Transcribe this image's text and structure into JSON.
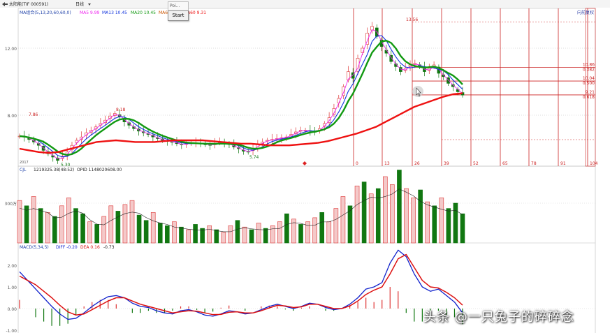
{
  "toolbar": {
    "back_icon": "back-arrow-icon",
    "stock_name": "太阳能(TIF 000591)",
    "period": "日线",
    "period_dropdown_icon": "chevron-down-icon"
  },
  "popup": {
    "tab_text": "Poi...",
    "start_label": "Start"
  },
  "price_panel": {
    "legend_name": "MA组合(5,13,20,60,60,0)",
    "ma5_label": "MA5 9.99",
    "ma13_label": "MA13 10.45",
    "ma20_label": "MA20 10.45",
    "ma_hidden_label": "MA6",
    "ma60_label": "A60 9.31",
    "corner_label": "向前复权",
    "bottom_left_label": "2017",
    "y_ticks": [
      "12.00",
      "8.00"
    ],
    "peak_label": "13.56",
    "annotations": [
      "7.86",
      "8.18",
      "5.30",
      "5.74"
    ],
    "fib_labels": [
      "10.86",
      "0.382",
      "10.04",
      "0.500",
      "9.21",
      "0.618"
    ],
    "time_ticks": [
      "0",
      "13",
      "26",
      "39",
      "52",
      "65",
      "78",
      "91",
      "104"
    ],
    "colors": {
      "ma5": "#ee22ee",
      "ma13": "#1133dd",
      "ma20": "#119911",
      "ma60": "#ee1111",
      "grid": "#cc2222",
      "up": "#dd3333",
      "down": "#117711"
    }
  },
  "volume_panel": {
    "legend_name": "CJL",
    "value_label": "1219325.38(48:52)",
    "opid_label": "OPID 1148020608.00",
    "y_tick": "300万"
  },
  "macd_panel": {
    "legend_name": "MACD(5,34,5)",
    "diff_label": "DIFF -0.20",
    "dea_label": "DEA 0.16",
    "macd_label": "-0.73",
    "y_ticks": [
      "2.00",
      "1.00",
      "0.00",
      "-1.00"
    ]
  },
  "watermark": "头条 @一只兔子的碎碎念",
  "chart_data": [
    {
      "type": "line",
      "title": "",
      "series_names": [
        "MA5",
        "MA13",
        "MA20",
        "MA60"
      ],
      "price_seq": [
        6.75,
        6.7,
        6.55,
        6.4,
        6.2,
        5.9,
        5.7,
        5.5,
        5.3,
        5.55,
        5.8,
        6.2,
        6.5,
        6.7,
        6.95,
        7.1,
        7.3,
        7.5,
        7.7,
        7.95,
        8.1,
        7.9,
        7.6,
        7.4,
        7.2,
        7.05,
        6.95,
        6.85,
        6.7,
        6.6,
        6.5,
        6.45,
        6.4,
        6.3,
        6.25,
        6.3,
        6.35,
        6.35,
        6.3,
        6.25,
        6.2,
        6.3,
        6.4,
        6.35,
        6.25,
        6.1,
        6.0,
        5.85,
        5.8,
        6.0,
        6.25,
        6.4,
        6.5,
        6.55,
        6.6,
        6.65,
        6.7,
        6.85,
        7.0,
        7.1,
        7.1,
        7.05,
        7.0,
        7.2,
        7.5,
        7.85,
        8.4,
        9.0,
        9.7,
        10.6,
        10.2,
        11.4,
        12.0,
        12.9,
        13.3,
        12.7,
        12.1,
        11.7,
        11.2,
        10.9,
        10.6,
        10.8,
        11.0,
        11.1,
        10.9,
        10.6,
        10.8,
        11.0,
        10.5,
        10.3,
        9.9,
        9.7,
        9.4,
        9.2
      ],
      "ma60_seq": [
        6.0,
        5.9,
        5.8,
        5.75,
        5.8,
        5.95,
        6.1,
        6.25,
        6.4,
        6.45,
        6.5,
        6.45,
        6.4,
        6.4,
        6.4,
        6.45,
        6.5,
        6.5,
        6.5,
        6.5,
        6.45,
        6.4,
        6.35,
        6.3,
        6.3,
        6.25,
        6.2,
        6.2,
        6.2,
        6.25,
        6.3,
        6.35,
        6.45,
        6.6,
        6.75,
        6.9,
        7.1,
        7.3,
        7.6,
        7.9,
        8.2,
        8.5,
        8.7,
        8.9,
        9.1,
        9.25,
        9.31
      ],
      "y_ticks": [
        12.0,
        8.0
      ],
      "peak": 13.56,
      "labels": {
        "high1": 7.86,
        "high2": 8.18,
        "low1": 5.3,
        "low2": 5.74
      },
      "fibonacci": [
        {
          "price": 10.86,
          "ratio": 0.382
        },
        {
          "price": 10.04,
          "ratio": 0.5
        },
        {
          "price": 9.21,
          "ratio": 0.618
        }
      ],
      "time_cycle": [
        0,
        13,
        26,
        39,
        52,
        65,
        78,
        91,
        104
      ]
    },
    {
      "type": "bar",
      "title": "",
      "y_ticks": [
        "300万"
      ],
      "volume_seq": [
        3.2,
        2.8,
        3.5,
        2.6,
        2.3,
        2.0,
        2.8,
        3.4,
        2.6,
        2.2,
        1.6,
        1.4,
        2.0,
        2.8,
        2.4,
        2.9,
        3.2,
        2.1,
        1.7,
        2.3,
        1.5,
        1.3,
        1.6,
        1.2,
        1.0,
        1.4,
        1.1,
        1.3,
        1.0,
        0.8,
        1.3,
        1.7,
        1.2,
        1.0,
        1.5,
        1.1,
        1.3,
        1.6,
        2.2,
        1.8,
        1.4,
        1.6,
        1.9,
        2.3,
        1.6,
        2.6,
        3.5,
        2.8,
        4.3,
        4.6,
        3.7,
        4.1,
        5.0,
        4.4,
        5.5,
        4.1,
        3.4,
        4.0,
        3.1,
        2.8,
        3.4,
        2.6,
        3.0,
        2.2
      ],
      "volume_up": [
        1,
        0,
        1,
        0,
        1,
        0,
        1,
        1,
        0,
        0,
        1,
        0,
        1,
        1,
        0,
        1,
        1,
        0,
        0,
        1,
        0,
        0,
        1,
        0,
        1,
        0,
        0,
        1,
        0,
        1,
        1,
        0,
        1,
        0,
        1,
        0,
        1,
        1,
        0,
        1,
        0,
        1,
        1,
        0,
        1,
        1,
        1,
        0,
        1,
        0,
        1,
        0,
        1,
        1,
        0,
        1,
        1,
        0,
        1,
        0,
        1,
        0,
        0,
        0
      ]
    },
    {
      "type": "line",
      "title": "",
      "series_names": [
        "DIFF",
        "DEA",
        "MACD"
      ],
      "y_ticks": [
        2.0,
        1.0,
        0.0,
        -1.0
      ],
      "diff_seq": [
        1.7,
        1.3,
        0.9,
        0.5,
        0.1,
        -0.25,
        -0.5,
        -0.45,
        -0.2,
        0.1,
        0.35,
        0.55,
        0.6,
        0.5,
        0.25,
        0.1,
        0.05,
        -0.1,
        -0.2,
        -0.25,
        -0.1,
        -0.05,
        -0.15,
        -0.3,
        -0.35,
        -0.25,
        -0.1,
        -0.15,
        -0.25,
        -0.2,
        -0.05,
        0.1,
        0.2,
        0.1,
        0.0,
        0.1,
        0.25,
        0.2,
        0.05,
        -0.05,
        0.0,
        0.2,
        0.5,
        0.9,
        1.0,
        1.2,
        2.1,
        2.7,
        2.4,
        1.6,
        1.0,
        0.8,
        0.9,
        0.6,
        0.3,
        -0.2
      ],
      "dea_seq": [
        1.5,
        1.3,
        1.1,
        0.8,
        0.5,
        0.15,
        -0.15,
        -0.3,
        -0.25,
        -0.05,
        0.15,
        0.35,
        0.5,
        0.5,
        0.35,
        0.2,
        0.1,
        0.0,
        -0.1,
        -0.2,
        -0.15,
        -0.1,
        -0.12,
        -0.2,
        -0.28,
        -0.27,
        -0.17,
        -0.15,
        -0.2,
        -0.2,
        -0.1,
        0.03,
        0.15,
        0.12,
        0.05,
        0.08,
        0.2,
        0.2,
        0.1,
        0.0,
        0.0,
        0.12,
        0.35,
        0.65,
        0.85,
        1.0,
        1.6,
        2.3,
        2.5,
        1.9,
        1.3,
        1.0,
        0.95,
        0.75,
        0.5,
        0.16
      ]
    }
  ]
}
